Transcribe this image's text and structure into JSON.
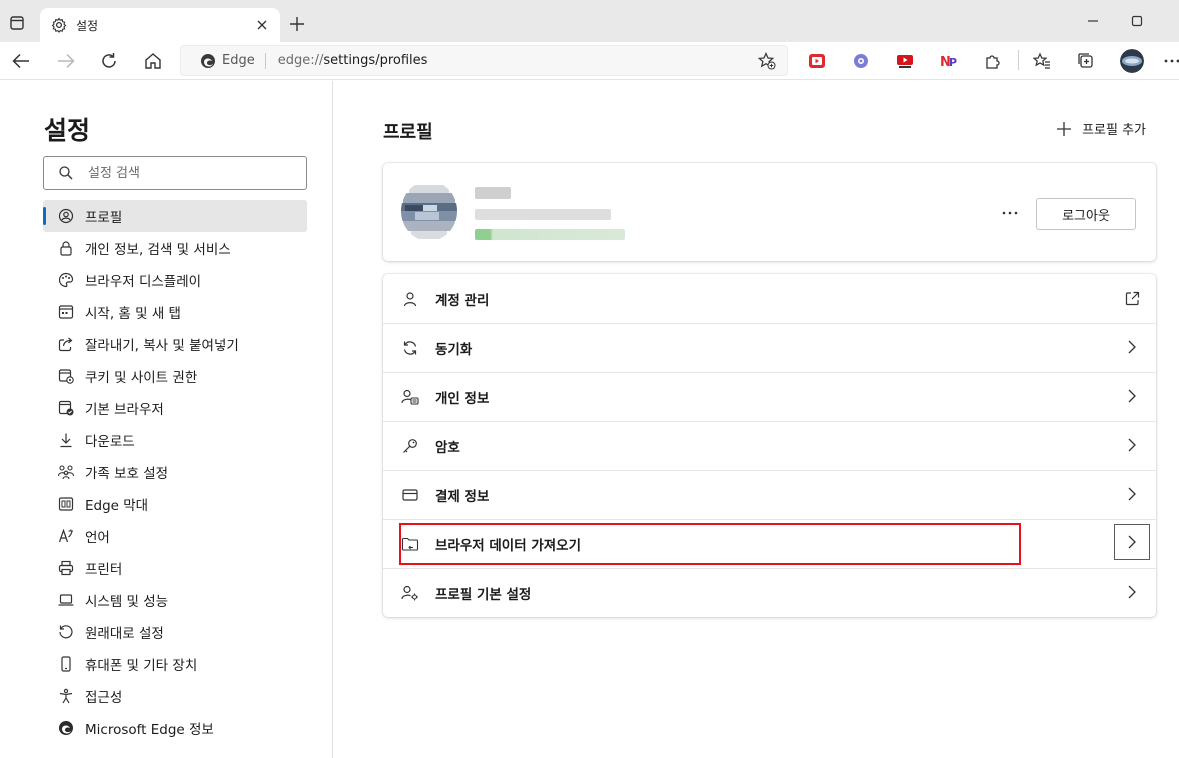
{
  "tab": {
    "title": "설정"
  },
  "address": {
    "site_label": "Edge",
    "url_protocol": "edge://",
    "url_path": "settings/profiles"
  },
  "extensions": [
    "youtube-red-icon",
    "gear-ext-icon",
    "youtube-ext-icon",
    "np-ext-icon",
    "puzzle-icon"
  ],
  "sidebar": {
    "title": "설정",
    "search_placeholder": "설정 검색",
    "items": [
      {
        "label": "프로필",
        "icon": "profile-icon",
        "active": true
      },
      {
        "label": "개인 정보, 검색 및 서비스",
        "icon": "lock-icon"
      },
      {
        "label": "브라우저 디스플레이",
        "icon": "palette-icon"
      },
      {
        "label": "시작, 홈 및 새 탭",
        "icon": "home-window-icon"
      },
      {
        "label": "잘라내기, 복사 및 붙여넣기",
        "icon": "share-icon"
      },
      {
        "label": "쿠키 및 사이트 권한",
        "icon": "site-permissions-icon"
      },
      {
        "label": "기본 브라우저",
        "icon": "default-browser-icon"
      },
      {
        "label": "다운로드",
        "icon": "download-icon"
      },
      {
        "label": "가족 보호 설정",
        "icon": "family-icon"
      },
      {
        "label": "Edge 막대",
        "icon": "edge-bar-icon"
      },
      {
        "label": "언어",
        "icon": "language-icon"
      },
      {
        "label": "프린터",
        "icon": "printer-icon"
      },
      {
        "label": "시스템 및 성능",
        "icon": "laptop-icon"
      },
      {
        "label": "원래대로 설정",
        "icon": "reset-icon"
      },
      {
        "label": "휴대폰 및 기타 장치",
        "icon": "phone-icon"
      },
      {
        "label": "접근성",
        "icon": "accessibility-icon"
      },
      {
        "label": "Microsoft Edge 정보",
        "icon": "edge-logo-icon"
      }
    ]
  },
  "main": {
    "title": "프로필",
    "add_profile": "프로필 추가",
    "logout": "로그아웃",
    "more": "···",
    "rows": [
      {
        "label": "계정 관리",
        "icon": "person-icon",
        "trailing": "external-link-icon"
      },
      {
        "label": "동기화",
        "icon": "sync-icon",
        "trailing": "chevron-right-icon"
      },
      {
        "label": "개인 정보",
        "icon": "personal-info-icon",
        "trailing": "chevron-right-icon"
      },
      {
        "label": "암호",
        "icon": "key-icon",
        "trailing": "chevron-right-icon"
      },
      {
        "label": "결제 정보",
        "icon": "card-icon",
        "trailing": "chevron-right-icon"
      },
      {
        "label": "브라우저 데이터 가져오기",
        "icon": "import-folder-icon",
        "trailing": "chevron-right-icon",
        "highlighted": true
      },
      {
        "label": "프로필 기본 설정",
        "icon": "profile-settings-icon",
        "trailing": "chevron-right-icon"
      }
    ]
  },
  "colors": {
    "accent": "#0f6cbd",
    "highlight": "#e8101b"
  }
}
